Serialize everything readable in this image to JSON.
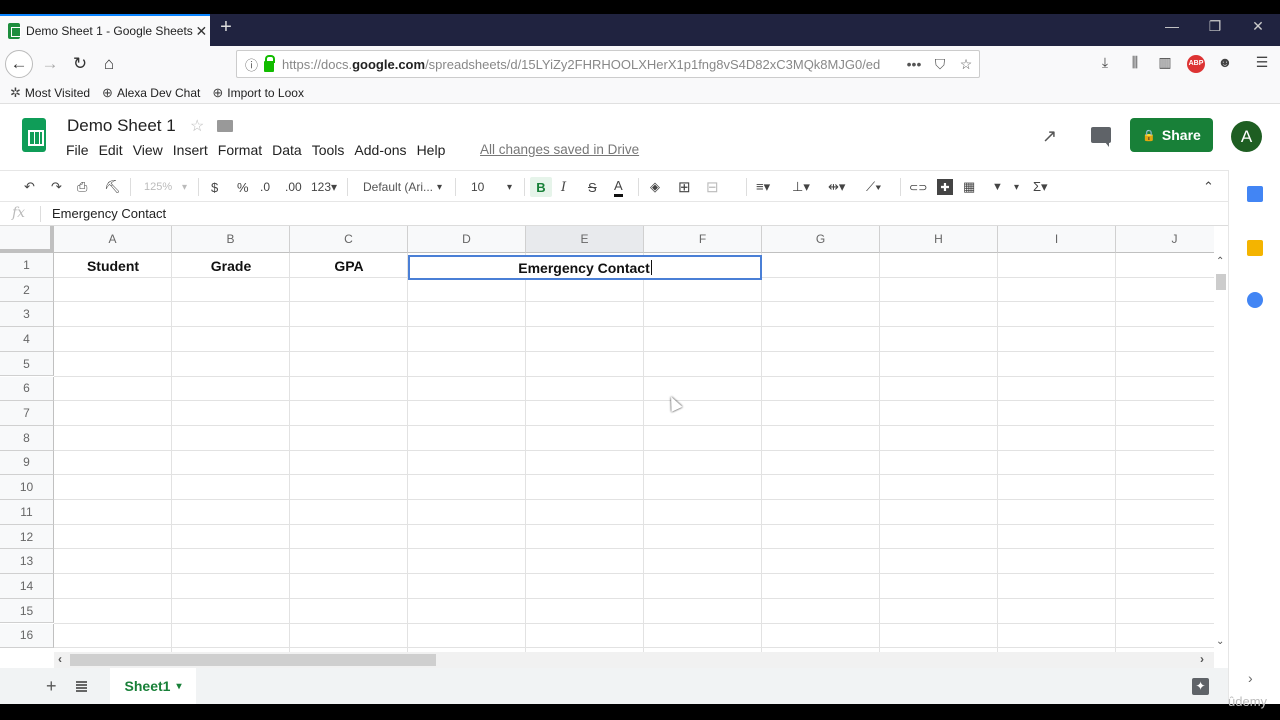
{
  "browser": {
    "tab_title": "Demo Sheet 1 - Google Sheets",
    "tab_close": "✕",
    "new_tab": "+",
    "window_controls": {
      "minimize": "—",
      "restore": "❐",
      "close": "✕"
    },
    "nav": {
      "back": "←",
      "forward": "→",
      "reload": "↻",
      "home": "⌂"
    },
    "url_prefix": "https://docs.",
    "url_domain": "google.com",
    "url_rest": "/spreadsheets/d/15LYiZy2FHRHOOLXHerX1p1fng8vS4D82xC3MQk8MJG0/ed",
    "url_actions": {
      "more": "•••",
      "pocket": "⛉",
      "bookmark": "☆"
    },
    "toolbar_icons": {
      "download": "⤓",
      "library": "⫼",
      "sidebar": "▥",
      "abp": "ABP",
      "account": "☻",
      "menu": "☰"
    },
    "bookmarks": [
      {
        "icon": "gear-icon",
        "glyph": "✲",
        "label": "Most Visited"
      },
      {
        "icon": "globe-icon",
        "glyph": "⊕",
        "label": "Alexa Dev Chat"
      },
      {
        "icon": "globe-icon",
        "glyph": "⊕",
        "label": "Import to Loox"
      }
    ]
  },
  "sheets": {
    "doc_title": "Demo Sheet 1",
    "star": "☆",
    "menu": [
      "File",
      "Edit",
      "View",
      "Insert",
      "Format",
      "Data",
      "Tools",
      "Add-ons",
      "Help"
    ],
    "save_status": "All changes saved in Drive",
    "share_label": "Share",
    "share_lock": "🔒",
    "avatar_letter": "A",
    "trend_glyph": "↗",
    "toolbar": {
      "undo": "↶",
      "redo": "↷",
      "print": "⎙",
      "paint_format": "⛏",
      "zoom": "125%",
      "zoom_caret": "▾",
      "currency": "$",
      "percent": "%",
      "dec_decrease": ".0",
      "dec_increase": ".00",
      "more_formats": "123▾",
      "font": "Default (Ari...",
      "font_caret": "▾",
      "font_size": "10",
      "size_caret": "▾",
      "bold": "B",
      "italic": "I",
      "strikethrough": "S",
      "text_color": "A",
      "fill": "◈",
      "borders": "⊞",
      "merge": "⊟",
      "halign": "≡▾",
      "valign": "⊥▾",
      "wrap": "⇹▾",
      "rotate": "⟋▾",
      "link": "⊂⊃",
      "comment": "✚",
      "chart": "▦",
      "filter": "▼",
      "filter_caret": "▾",
      "functions": "Σ▾",
      "collapse": "⌃"
    },
    "formula_bar": {
      "fx": "fx",
      "value": "Emergency Contact"
    },
    "columns": [
      "A",
      "B",
      "C",
      "D",
      "E",
      "F",
      "G",
      "H",
      "I",
      "J"
    ],
    "rows": [
      "1",
      "2",
      "3",
      "4",
      "5",
      "6",
      "7",
      "8",
      "9",
      "10",
      "11",
      "12",
      "13",
      "14",
      "15",
      "16"
    ],
    "cells": {
      "A1": "Student",
      "B1": "Grade",
      "C1": "GPA"
    },
    "editing_cell": {
      "ref": "D1:F1",
      "value": "Emergency Contact"
    },
    "selected_column": "E",
    "scroll": {
      "up": "⌃",
      "down": "⌄",
      "left": "‹",
      "right": "›"
    },
    "sheet_bar": {
      "add": "+",
      "sheet_name": "Sheet1",
      "sheet_caret": "▾",
      "explore": "✦"
    },
    "side_panel_chevron": "›"
  },
  "watermark": "ûdemy"
}
